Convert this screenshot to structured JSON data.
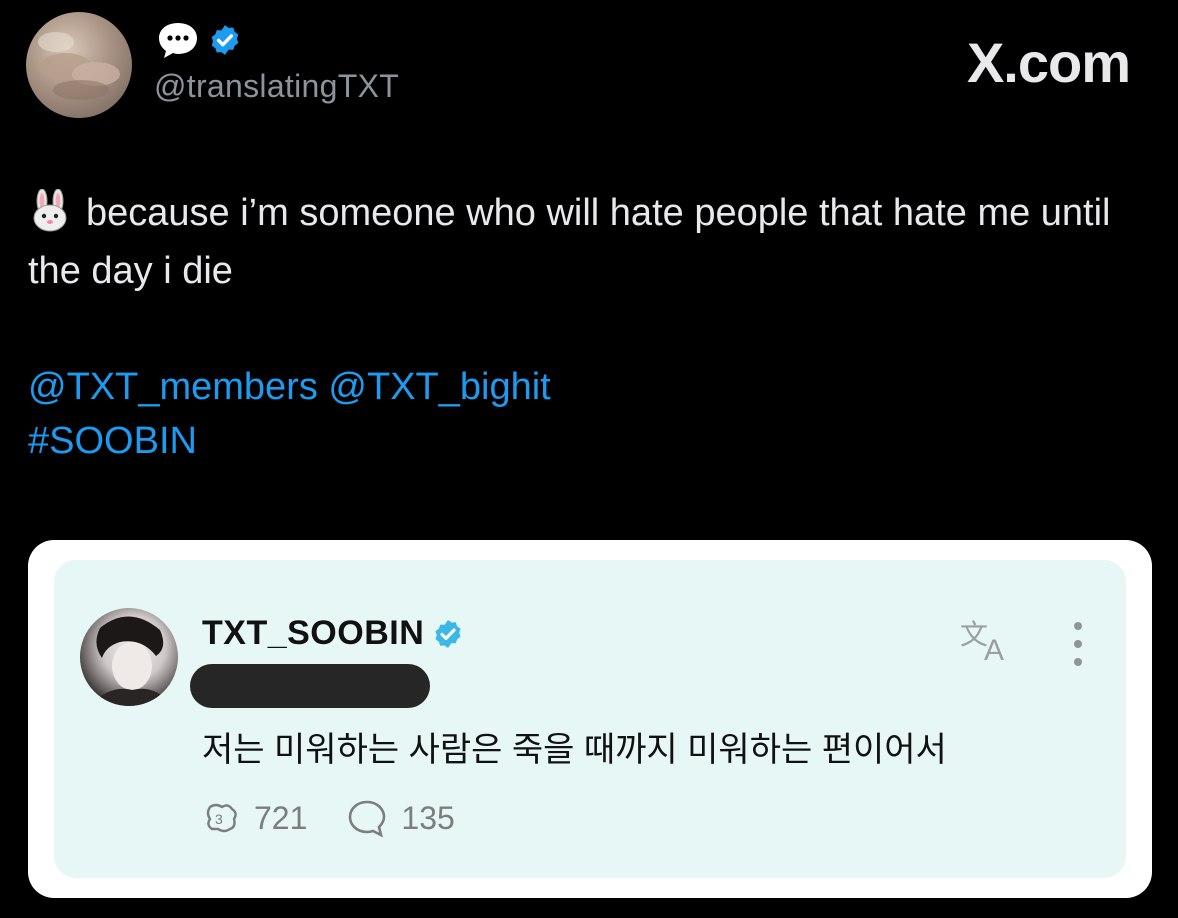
{
  "tweet": {
    "handle": "@translatingTXT",
    "site_watermark": "X.com",
    "text": "because i’m someone who will hate people that hate me until the day i die",
    "emoji": "rabbit-face-emoji",
    "mentions": [
      "@TXT_members",
      "@TXT_bighit"
    ],
    "hashtag": "#SOOBIN",
    "colors": {
      "background": "#000000",
      "text": "#e7e9ea",
      "link": "#1d9bf0",
      "muted": "#8b949c",
      "verified": "#1d9bf0"
    }
  },
  "embedded_post": {
    "username": "TXT_SOOBIN",
    "text": "저는 미워하는 사람은 죽을 때까지 미워하는 편이어서",
    "repost_count": "721",
    "reply_count": "135",
    "colors": {
      "card_background": "#e6f7f6",
      "verified": "#3ab8e6"
    }
  }
}
